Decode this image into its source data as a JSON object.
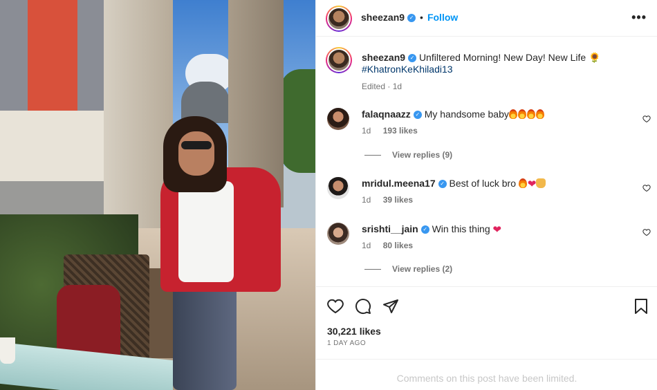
{
  "post": {
    "author": "sheezan9",
    "follow_label": "Follow",
    "more_label": "•••",
    "caption_text": "Unfiltered Morning! New Day! New Life 🌻",
    "hashtag": "#KhatronKeKhiladi13",
    "edited_label": "Edited",
    "edited_time": "1d"
  },
  "comments": [
    {
      "user": "falaqnaazz",
      "text": "My handsome baby",
      "emoji": [
        "fire",
        "fire",
        "fire",
        "fire"
      ],
      "time": "1d",
      "likes": "193 likes",
      "replies": "View replies (9)"
    },
    {
      "user": "mridul.meena17",
      "text": "Best of luck bro",
      "emoji": [
        "fire",
        "heart",
        "pray"
      ],
      "time": "1d",
      "likes": "39 likes",
      "replies": ""
    },
    {
      "user": "srishti__jain",
      "text": "Win this thing",
      "emoji": [
        "heart"
      ],
      "time": "1d",
      "likes": "80 likes",
      "replies": "View replies (2)"
    }
  ],
  "footer": {
    "likes_count": "30,221 likes",
    "post_date": "1 DAY AGO",
    "limited_text": "Comments on this post have been limited."
  },
  "icons": {
    "like": "heart-icon",
    "comment": "comment-icon",
    "share": "share-icon",
    "save": "bookmark-icon",
    "verified": "verified-badge-icon"
  },
  "colors": {
    "accent": "#0095f6",
    "verified": "#3897f0",
    "muted": "#737373",
    "limited_text": "#c7c7c7"
  }
}
